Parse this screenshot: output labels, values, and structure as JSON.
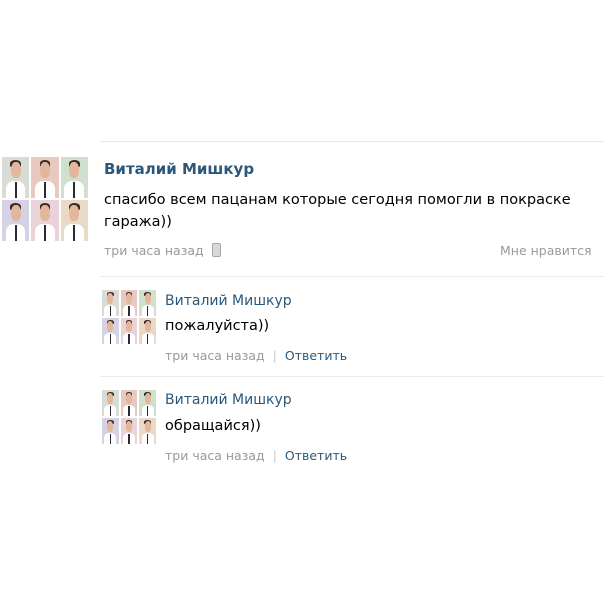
{
  "post": {
    "author": "Виталий Мишкур",
    "text_line1": "спасибо всем пацанам которые сегодня помогли в покраске",
    "text_line2": "гаража))",
    "time": "три часа назад",
    "like_label": "Мне нравится",
    "device_icon": "phone-icon"
  },
  "replies": [
    {
      "author": "Виталий Мишкур",
      "text": "пожалуйста))",
      "time": "три часа назад",
      "separator": "|",
      "reply_label": "Ответить"
    },
    {
      "author": "Виталий Мишкур",
      "text": "обращайся))",
      "time": "три часа назад",
      "separator": "|",
      "reply_label": "Ответить"
    }
  ],
  "colors": {
    "author_link": "#2b587a",
    "meta_gray": "#999999",
    "divider": "#e7ebf0",
    "background": "#ffffff"
  }
}
